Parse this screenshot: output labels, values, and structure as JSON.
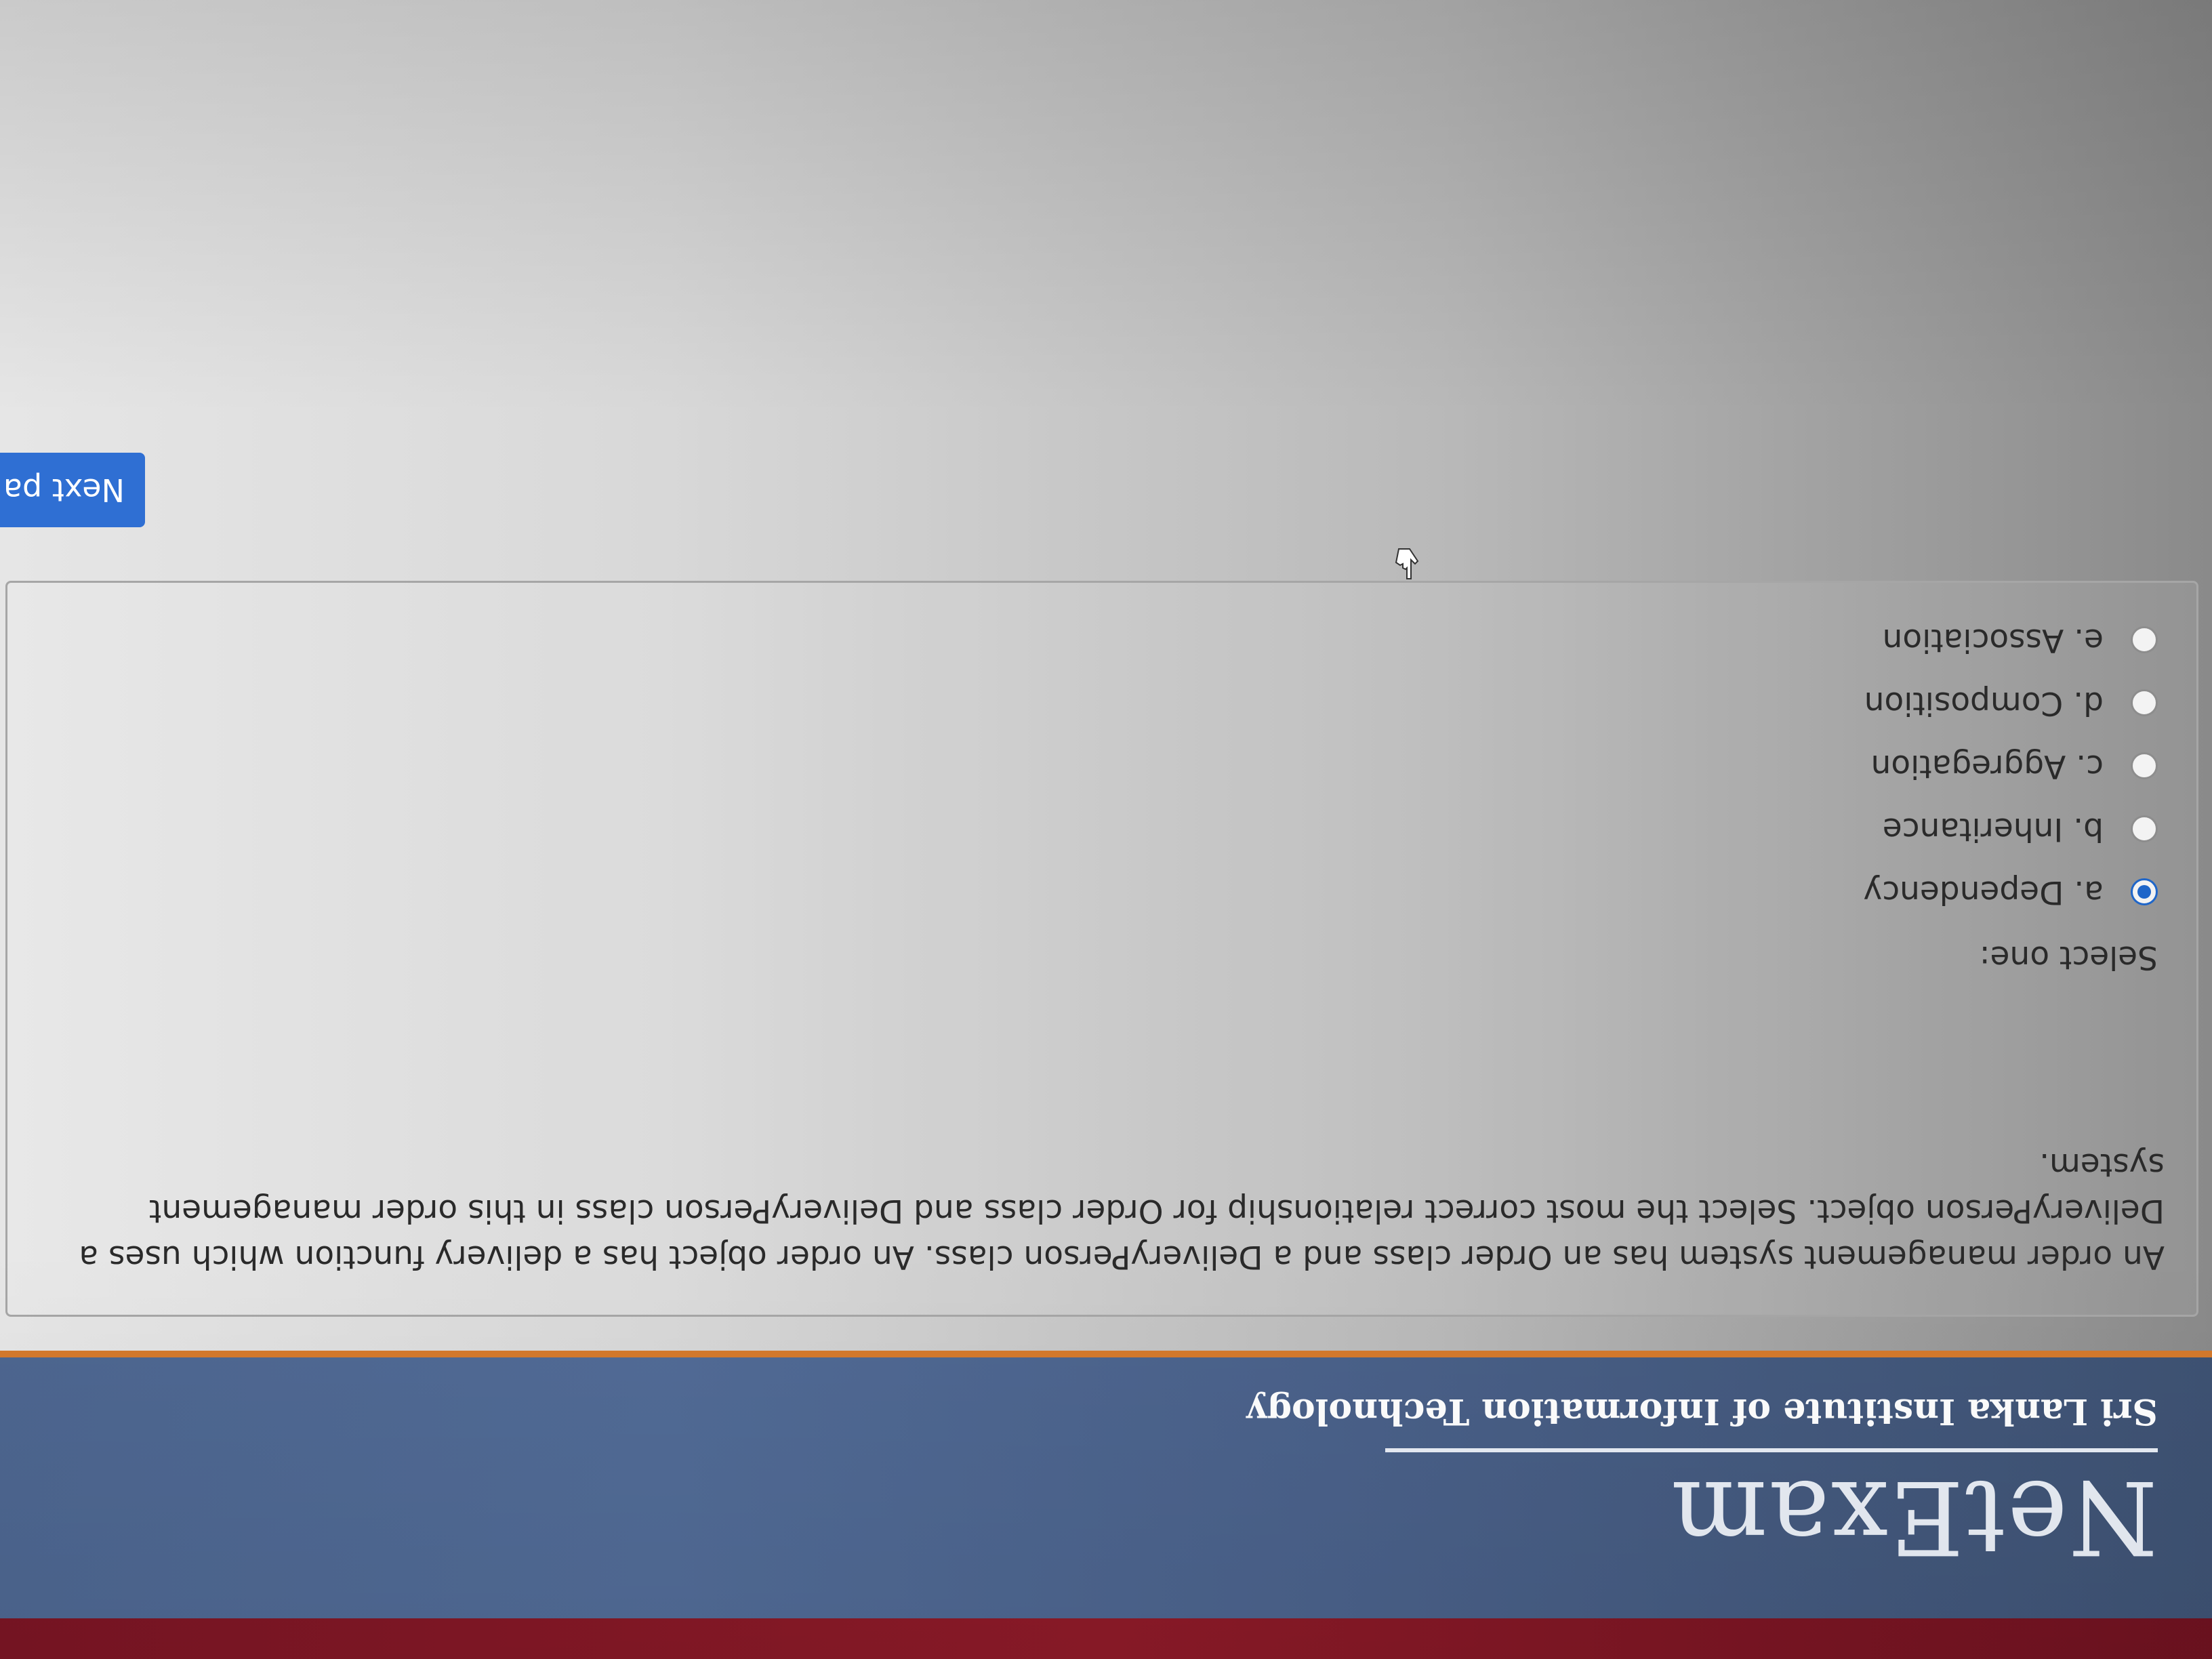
{
  "header": {
    "logo_text": "NetExam",
    "institute": "Sri Lanka Institute of Information Technology"
  },
  "question": {
    "text": "An order management system has an Order class and a DeliveryPerson class. An order object has a delivery function which uses a DeliveryPerson object. Select the most correct relationship for Order class and DeliveryPerson class in this order management system.",
    "select_label": "Select one:",
    "options": [
      {
        "label": "a. Dependency",
        "checked": true
      },
      {
        "label": "b. Inheritance",
        "checked": false
      },
      {
        "label": "c. Aggregation",
        "checked": false
      },
      {
        "label": "d. Composition",
        "checked": false
      },
      {
        "label": "e. Association",
        "checked": false
      }
    ],
    "selected_color": "#1f66c9"
  },
  "navigation": {
    "next_label": "Next pa"
  },
  "colors": {
    "header_bg": "#4a618a",
    "accent_line": "#d57a2c",
    "button_bg": "#2f6fd3"
  },
  "icons": {
    "cursor": "hand-pointer-icon"
  }
}
